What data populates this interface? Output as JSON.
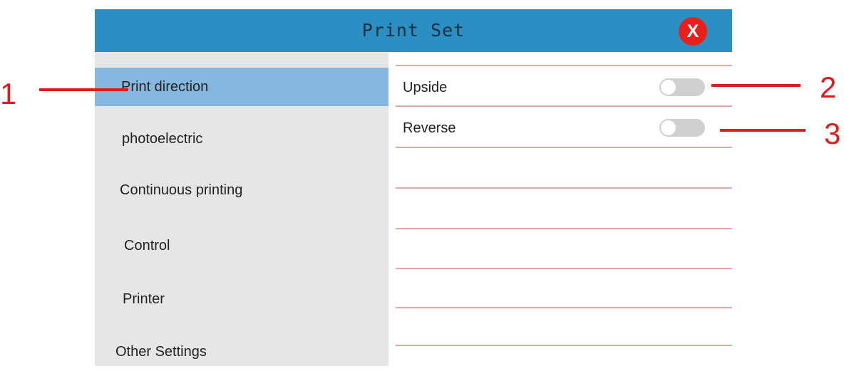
{
  "window": {
    "title": "Print Set"
  },
  "close_button": {
    "label": "X",
    "color": "#e8201b"
  },
  "colors": {
    "titlebar": "#2b8fc4",
    "sidebar_bg": "#e6e6e6",
    "sidebar_active": "#86b8df",
    "row_divider": "#e3a9a9",
    "toggle_off": "#d0d0d0",
    "callout": "#e21b1b"
  },
  "sidebar": {
    "items": [
      {
        "label": "Print direction",
        "active": true
      },
      {
        "label": "photoelectric",
        "active": false
      },
      {
        "label": "Continuous printing",
        "active": false
      },
      {
        "label": "Control",
        "active": false
      },
      {
        "label": "Printer",
        "active": false
      },
      {
        "label": "Other Settings",
        "active": false
      }
    ]
  },
  "settings": [
    {
      "label": "Upside",
      "enabled": false
    },
    {
      "label": "Reverse",
      "enabled": false
    }
  ],
  "callouts": [
    "1",
    "2",
    "3"
  ]
}
